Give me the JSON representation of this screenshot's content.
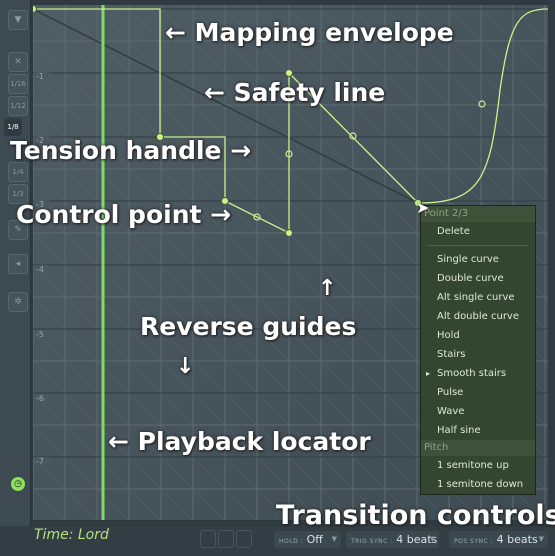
{
  "toolbar": {
    "items": [
      {
        "icon": "menu-arrow-icon",
        "label": "▼"
      },
      {
        "icon": "close-icon",
        "label": "✕"
      },
      {
        "icon": "snap-1-16-icon",
        "label": "1/16"
      },
      {
        "icon": "snap-1-12-icon",
        "label": "1/12"
      },
      {
        "icon": "snap-1-8-icon",
        "label": "1/8"
      },
      {
        "icon": "snap-1-4-icon",
        "label": "1/4"
      },
      {
        "icon": "snap-1-3-icon",
        "label": "1/3"
      },
      {
        "icon": "pencil-icon",
        "label": "✎"
      },
      {
        "icon": "speaker-icon",
        "label": "◂"
      },
      {
        "icon": "gear-icon",
        "label": "✲"
      }
    ],
    "clock_icon": "clock-icon"
  },
  "grid": {
    "bar_labels": [
      "-1",
      "-2",
      "-3",
      "-4",
      "-5",
      "-6",
      "-7"
    ]
  },
  "annotations": {
    "mapping_envelope": "Mapping envelope",
    "safety_line": "Safety line",
    "tension_handle": "Tension handle",
    "control_point": "Control point",
    "reverse_guides": "Reverse guides",
    "playback_locator": "Playback locator",
    "transition_controls": "Transition controls"
  },
  "context_menu": {
    "header": "Point 2/3",
    "delete": "Delete",
    "items": [
      "Single curve",
      "Double curve",
      "Alt single curve",
      "Alt double curve",
      "Hold",
      "Stairs",
      "Smooth stairs",
      "Pulse",
      "Wave",
      "Half sine"
    ],
    "selected": "Smooth stairs",
    "pitch_header": "Pitch",
    "pitch_items": [
      "1 semitone up",
      "1 semitone down"
    ]
  },
  "footer": {
    "time_label": "Time: Lord",
    "hold_label": "HOLD :",
    "hold_value": "Off",
    "trig_sync_label": "TRIG SYNC :",
    "trig_sync_value": "4 beats",
    "pos_sync_label": "POS SYNC :",
    "pos_sync_value": "4 beats"
  },
  "colors": {
    "envelope": "#c9f28a",
    "locator": "#7fdc6a",
    "menu_bg": "#34462f",
    "time_text": "#b8e07a"
  }
}
